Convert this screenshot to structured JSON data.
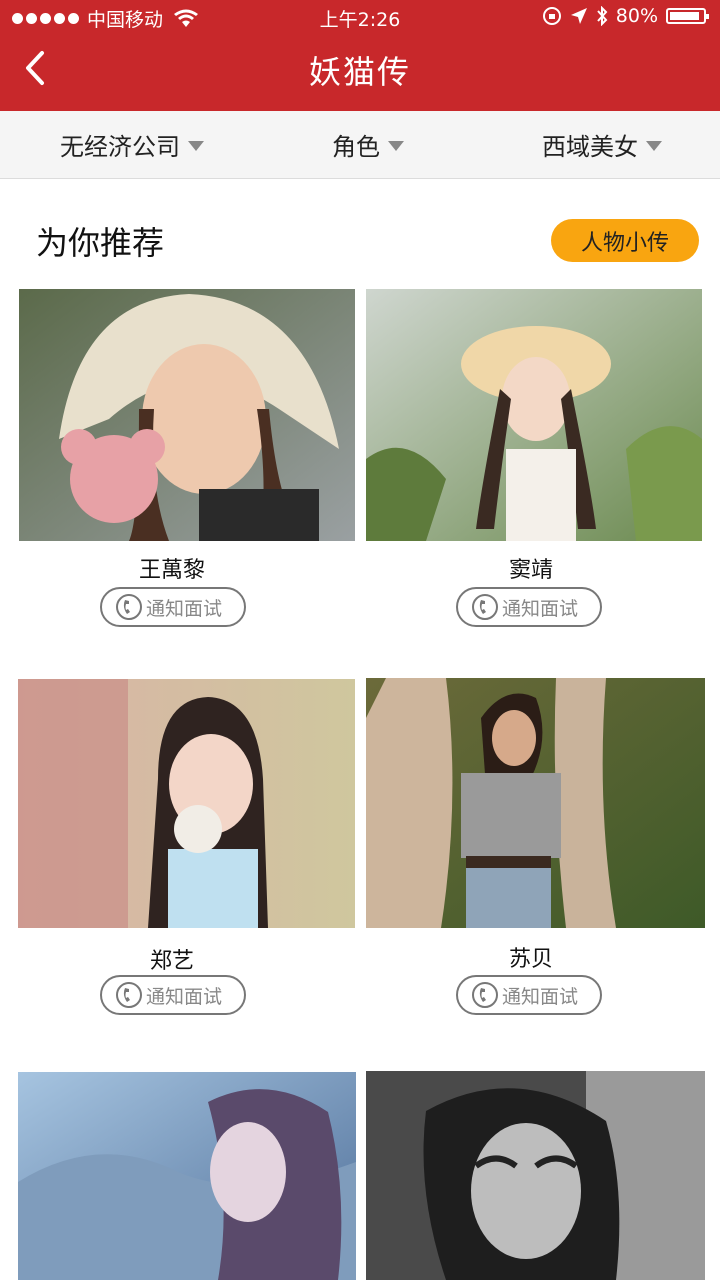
{
  "status_bar": {
    "carrier": "中国移动",
    "time": "上午2:26",
    "battery": "80%"
  },
  "header": {
    "title": "妖猫传",
    "back_icon": "chevron-left-icon"
  },
  "filters": [
    {
      "label": "无经济公司"
    },
    {
      "label": "角色"
    },
    {
      "label": "西域美女"
    }
  ],
  "section": {
    "title": "为你推荐",
    "story_button": "人物小传"
  },
  "cards": [
    {
      "name": "王萬黎",
      "action": "通知面试"
    },
    {
      "name": "窦靖",
      "action": "通知面试"
    },
    {
      "name": "郑艺",
      "action": "通知面试"
    },
    {
      "name": "苏贝",
      "action": "通知面试"
    }
  ],
  "colors": {
    "header": "#c8282b",
    "accent": "#f9a510",
    "filter_bg": "#f5f5f5"
  }
}
